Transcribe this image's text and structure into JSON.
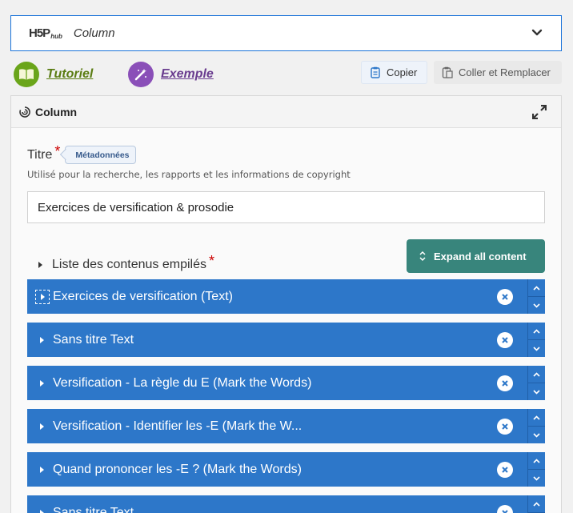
{
  "hub": {
    "logo_main": "H5P",
    "logo_sub": "hub",
    "title": "Column"
  },
  "help": {
    "tutorial": "Tutoriel",
    "example": "Exemple"
  },
  "toolbar": {
    "copy": "Copier",
    "paste_replace": "Coller et Remplacer"
  },
  "panel": {
    "title": "Column",
    "field_title": {
      "label": "Titre",
      "required_mark": "*",
      "metadata_badge": "Métadonnées",
      "description": "Utilisé pour la recherche, les rapports et les informations de copyright",
      "value": "Exercices de versification & prosodie"
    },
    "list": {
      "label": "Liste des contenus empilés",
      "required_mark": "*",
      "expand_all": "Expand all content",
      "items": [
        {
          "label": "Exercices de versification (Text)"
        },
        {
          "label": "Sans titre Text"
        },
        {
          "label": "Versification - La règle du E (Mark the Words)"
        },
        {
          "label": "Versification - Identifier les -E (Mark the W..."
        },
        {
          "label": "Quand prononcer les -E ? (Mark the Words)"
        },
        {
          "label": "Sans titre Text"
        }
      ]
    }
  },
  "colors": {
    "accent_blue": "#2d77c9",
    "expand_button": "#38857c",
    "tutorial": "#5a7c12",
    "example": "#6a3d8f",
    "required": "#cc0000"
  },
  "icons": [
    "chevron-down-icon",
    "book-icon",
    "magic-wand-icon",
    "clipboard-icon",
    "paste-icon",
    "column-icon",
    "fullscreen-icon",
    "sort-icon",
    "remove-icon",
    "move-up-icon",
    "move-down-icon"
  ]
}
